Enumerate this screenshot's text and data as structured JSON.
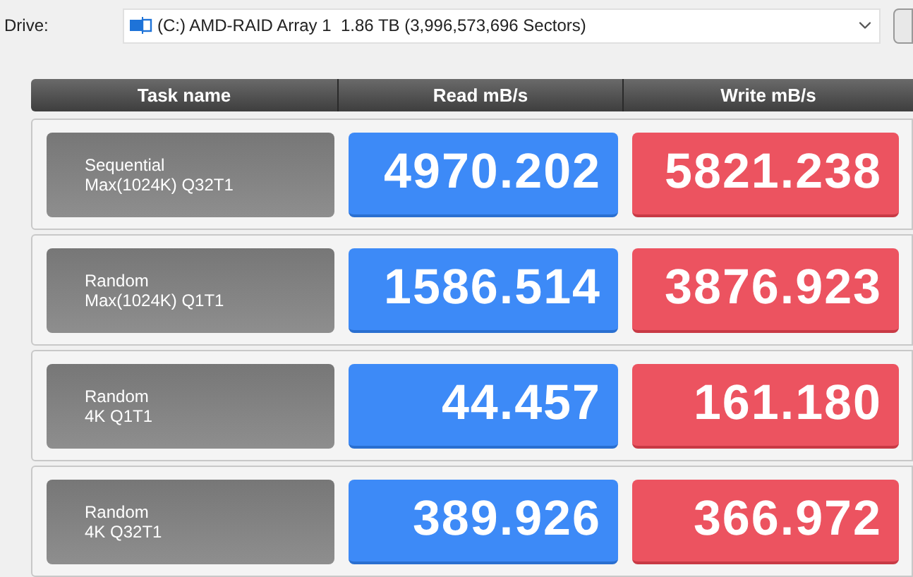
{
  "drive": {
    "label": "Drive:",
    "value": "(C:) AMD-RAID Array 1  1.86 TB (3,996,573,696 Sectors)"
  },
  "columns": [
    "Task name",
    "Read mB/s",
    "Write mB/s"
  ],
  "rows": [
    {
      "task": [
        "Sequential",
        "Max(1024K) Q32T1"
      ],
      "read": "4970.202",
      "write": "5821.238"
    },
    {
      "task": [
        "Random",
        "Max(1024K) Q1T1"
      ],
      "read": "1586.514",
      "write": "3876.923"
    },
    {
      "task": [
        "Random",
        "4K Q1T1"
      ],
      "read": "44.457",
      "write": "161.180"
    },
    {
      "task": [
        "Random",
        "4K Q32T1"
      ],
      "read": "389.926",
      "write": "366.972"
    }
  ]
}
